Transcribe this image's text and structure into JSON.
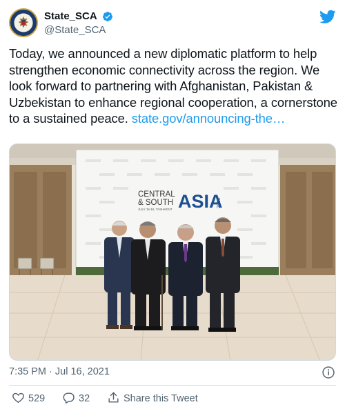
{
  "account": {
    "display_name": "State_SCA",
    "handle": "@State_SCA",
    "verified": true
  },
  "tweet": {
    "text": "Today, we announced a new diplomatic platform to help strengthen economic connectivity across the region. We look forward to partnering with Afghanistan, Pakistan & Uzbekistan to enhance regional cooperation, a cornerstone to a sustained peace. ",
    "link_text": "state.gov/announcing-the…",
    "timestamp": "7:35 PM · Jul 16, 2021"
  },
  "photo": {
    "backdrop_line1": "CENTRAL",
    "backdrop_line2": "& SOUTH",
    "backdrop_main": "ASIA",
    "backdrop_year": "2021",
    "backdrop_sub": "JULY 15-16, TASHKENT"
  },
  "actions": {
    "likes": "529",
    "replies": "32",
    "share_label": "Share this Tweet"
  },
  "icons": {
    "twitter": "twitter-bird-icon",
    "verified": "verified-badge-icon",
    "info": "info-icon",
    "like": "heart-icon",
    "reply": "reply-icon",
    "share": "share-icon"
  },
  "colors": {
    "twitter_blue": "#1d9bf0",
    "text": "#0f1419",
    "muted": "#536471",
    "border": "#cfd9de"
  }
}
